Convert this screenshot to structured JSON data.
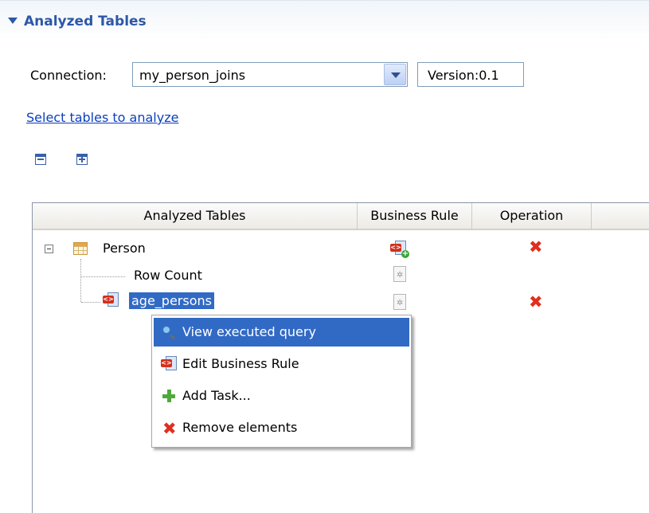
{
  "section": {
    "title": "Analyzed Tables"
  },
  "connection": {
    "label": "Connection:",
    "value": "my_person_joins",
    "version": "Version:0.1"
  },
  "select_link": "Select tables to analyze",
  "tree": {
    "columns": [
      "Analyzed Tables",
      "Business Rule",
      "Operation"
    ],
    "rows": [
      {
        "label": "Person"
      },
      {
        "label": "Row Count"
      },
      {
        "label": "age_persons"
      }
    ]
  },
  "context_menu": {
    "items": [
      {
        "label": "View executed query",
        "icon": "magnifier-icon"
      },
      {
        "label": "Edit Business Rule",
        "icon": "business-rule-icon"
      },
      {
        "label": "Add Task...",
        "icon": "add-icon"
      },
      {
        "label": "Remove elements",
        "icon": "remove-icon"
      }
    ]
  },
  "colors": {
    "accent": "#2d58a6",
    "selection": "#316ac5",
    "delete_red": "#e02f1e",
    "link": "#0b3fbd"
  }
}
